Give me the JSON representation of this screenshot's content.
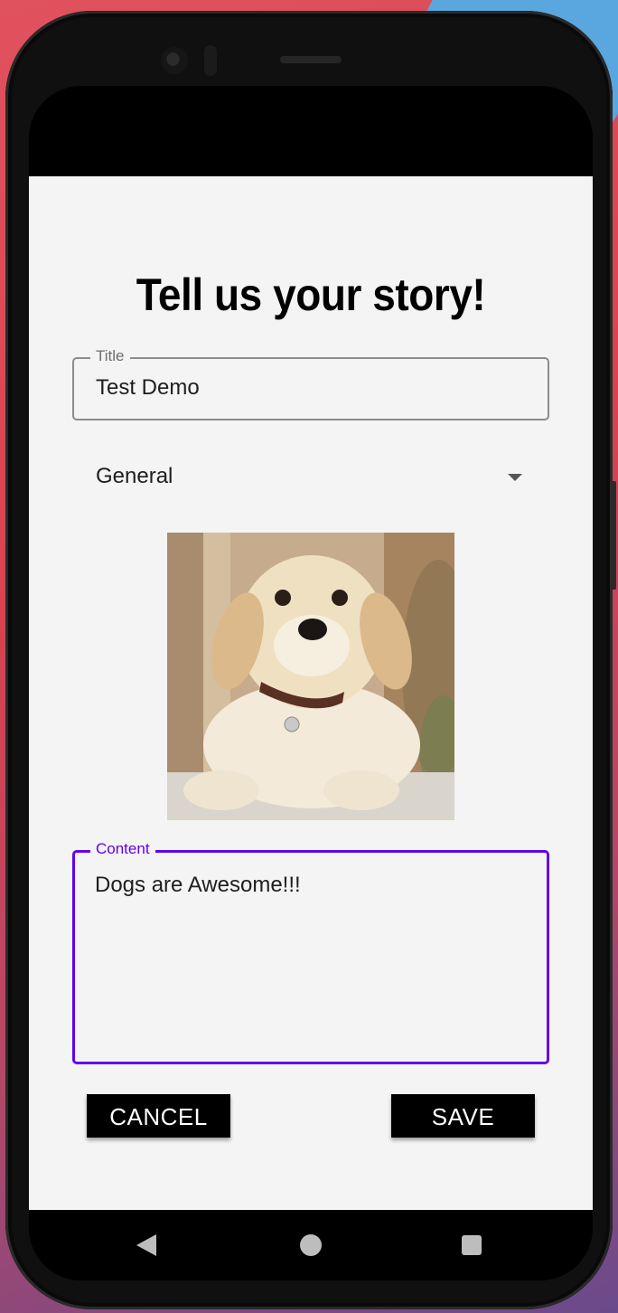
{
  "page": {
    "title": "Tell us your story!"
  },
  "form": {
    "title_field": {
      "label": "Title",
      "value": "Test Demo"
    },
    "category": {
      "selected": "General"
    },
    "image": {
      "icon": "puppy-photo"
    },
    "content_field": {
      "label": "Content",
      "value": "Dogs are Awesome!!!"
    }
  },
  "buttons": {
    "cancel_label": "CANCEL",
    "save_label": "SAVE"
  },
  "nav": {
    "back_icon": "back-triangle-icon",
    "home_icon": "home-circle-icon",
    "recents_icon": "recents-square-icon"
  },
  "colors": {
    "accent": "#6200ee",
    "button_bg": "#000000",
    "screen_bg": "#f4f4f4"
  }
}
